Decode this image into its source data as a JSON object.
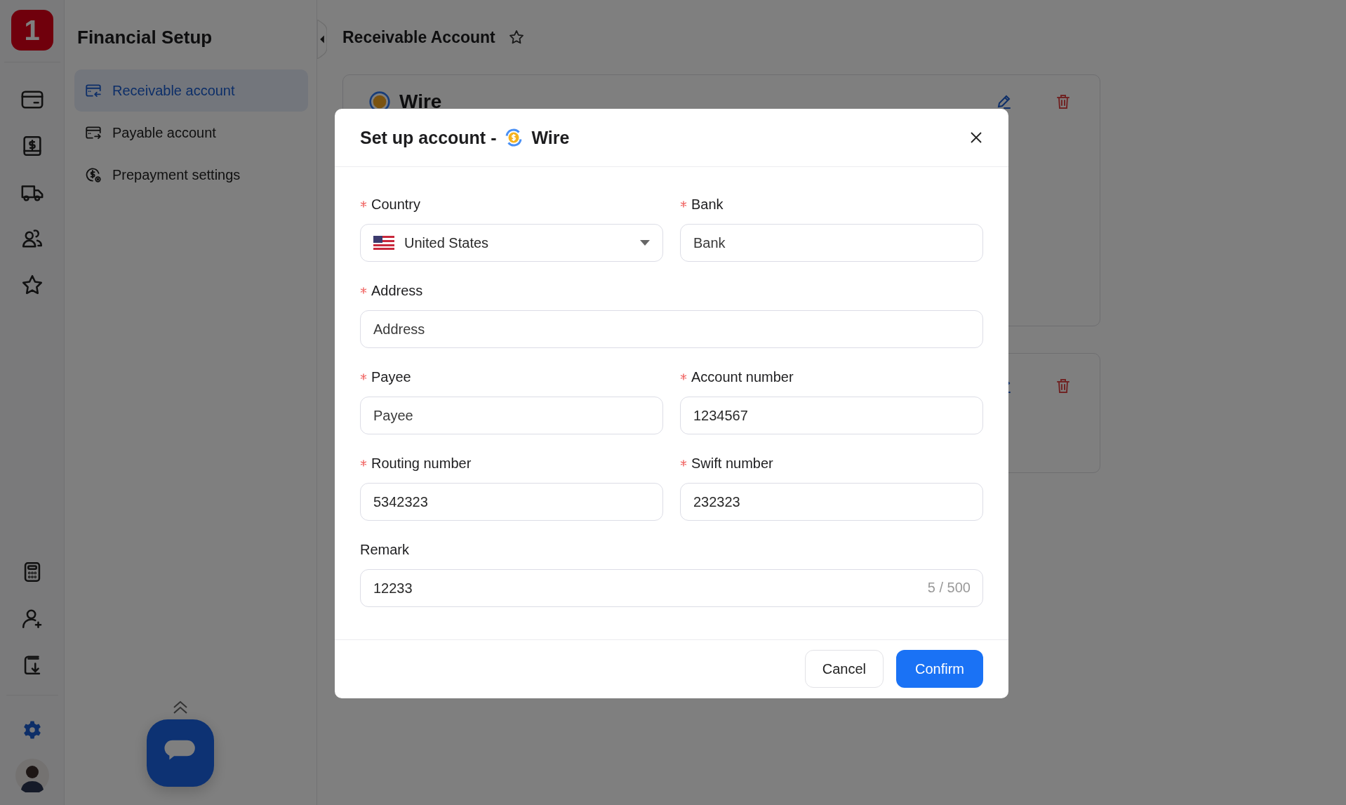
{
  "rail": {
    "logo": "1",
    "top_items": [
      {
        "kind": "card",
        "selected": false
      },
      {
        "kind": "dollar-book",
        "selected": false
      },
      {
        "kind": "truck",
        "selected": false
      },
      {
        "kind": "users",
        "selected": false
      },
      {
        "kind": "star",
        "selected": false
      }
    ],
    "bottom_items": [
      {
        "kind": "calculator",
        "selected": false
      },
      {
        "kind": "user-plus",
        "selected": false
      },
      {
        "kind": "book-download",
        "selected": false
      }
    ],
    "settings": {
      "selected": true
    }
  },
  "sidebar": {
    "title": "Financial Setup",
    "items": [
      {
        "label": "Receivable account",
        "kind": "receive",
        "selected": true
      },
      {
        "label": "Payable account",
        "kind": "pay",
        "selected": false
      },
      {
        "label": "Prepayment settings",
        "kind": "prepay",
        "selected": false
      }
    ]
  },
  "main": {
    "title": "Receivable Account",
    "cards": [
      {
        "kind": "titled",
        "title": "Wire"
      },
      {
        "kind": "untitled"
      }
    ]
  },
  "dialog": {
    "title": "Set up account -",
    "method": "Wire",
    "rows": [
      [
        {
          "label": "Country",
          "required": true,
          "kind": "select",
          "value": "United States"
        },
        {
          "label": "Bank",
          "required": true,
          "kind": "text",
          "placeholder": "Bank"
        }
      ],
      [
        {
          "label": "Address",
          "required": true,
          "kind": "text",
          "placeholder": "Address"
        }
      ],
      [
        {
          "label": "Payee",
          "required": true,
          "kind": "text",
          "placeholder": "Payee"
        },
        {
          "label": "Account number",
          "required": true,
          "kind": "text",
          "value": "1234567"
        }
      ],
      [
        {
          "label": "Routing number",
          "required": true,
          "kind": "text",
          "value": "5342323"
        },
        {
          "label": "Swift number",
          "required": true,
          "kind": "text",
          "value": "232323"
        }
      ],
      [
        {
          "label": "Remark",
          "required": false,
          "kind": "counter",
          "value": "12233",
          "counter": "5 / 500"
        }
      ]
    ],
    "buttons": [
      {
        "label": "Cancel",
        "kind": "secondary"
      },
      {
        "label": "Confirm",
        "kind": "primary"
      }
    ]
  }
}
